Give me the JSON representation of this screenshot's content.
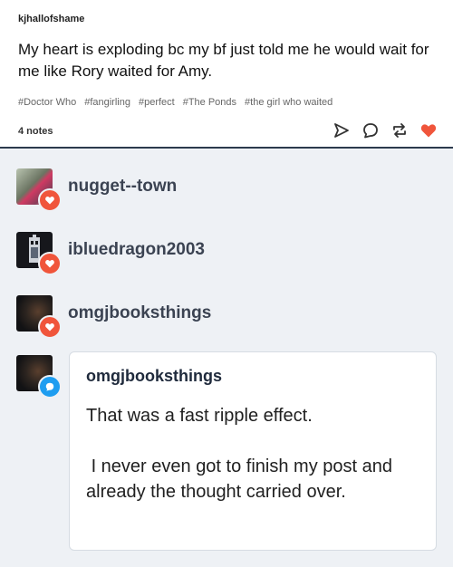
{
  "post": {
    "username": "kjhallofshame",
    "body": "My heart is exploding bc my bf just told me he would wait for me like Rory waited for Amy.",
    "tags": [
      "#Doctor Who",
      "#fangirling",
      "#perfect",
      "#The Ponds",
      "#the girl who waited"
    ],
    "notes": "4 notes",
    "icons": [
      "send-icon",
      "reply-icon",
      "reblog-icon",
      "heart-icon"
    ],
    "colors": {
      "heart": "#f0553b",
      "border": "#2c3a4d"
    }
  },
  "feed": {
    "background": "#eef1f5",
    "notes": [
      {
        "username": "nugget--town",
        "type": "like"
      },
      {
        "username": "ibluedragon2003",
        "type": "like"
      },
      {
        "username": "omgjbooksthings",
        "type": "like"
      },
      {
        "username": "omgjbooksthings",
        "type": "reply"
      }
    ],
    "reply": {
      "username": "omgjbooksthings",
      "text": "That was a fast ripple effect.\n\n I never even got to finish my post and already the thought carried over."
    },
    "colors": {
      "like_badge": "#f0553b",
      "reply_badge": "#1e9df0"
    }
  }
}
